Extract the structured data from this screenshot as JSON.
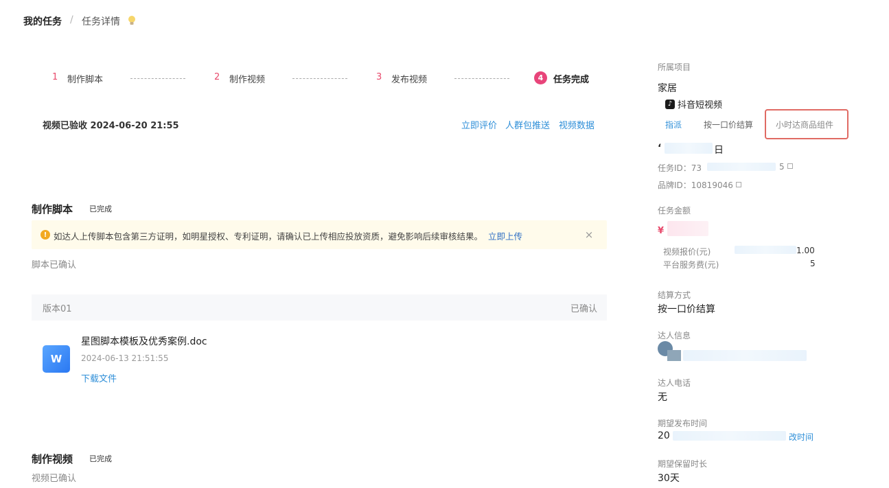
{
  "breadcrumb": {
    "root": "我的任务",
    "separator": "/",
    "current": "任务详情"
  },
  "steps": [
    {
      "number": "1",
      "label": "制作脚本"
    },
    {
      "number": "2",
      "label": "制作视频"
    },
    {
      "number": "3",
      "label": "发布视频"
    },
    {
      "number": "4",
      "label": "任务完成"
    }
  ],
  "status": {
    "text": "视频已验收 2024-06-20 21:55",
    "actions": [
      "立即评价",
      "人群包推送",
      "视频数据"
    ]
  },
  "script_section": {
    "title": "制作脚本",
    "badge": "已完成",
    "alert_text": "如达人上传脚本包含第三方证明，如明星授权、专利证明，请确认已上传相应投放资质，避免影响后续审核结果。",
    "alert_link": "立即上传",
    "alert_icon": "!",
    "alert_close": "×",
    "confirmed_text": "脚本已确认",
    "version": {
      "label": "版本01",
      "status": "已确认"
    },
    "file": {
      "icon_letter": "W",
      "name": "星图脚本模板及优秀案例.doc",
      "time": "2024-06-13 21:51:55",
      "download": "下载文件"
    }
  },
  "video_section": {
    "title": "制作视频",
    "badge": "已完成",
    "confirmed_text": "视频已确认"
  },
  "sidebar": {
    "project_label": "所属项目",
    "project_value": "家居",
    "platform": "抖音短视频",
    "tags": [
      "指派",
      "按一口价结算",
      "小时达商品组件"
    ],
    "task_name_partial": "日",
    "task_id_label": "任务ID：73",
    "task_id_tail": "5",
    "brand_id_label": "品牌ID：10819046",
    "amount_label": "任务金额",
    "amount_mark": "¥",
    "quote_label": "视频报价(元)",
    "fee_label": "平台服务费(元)",
    "quote_tail": "1.00",
    "fee_tail": "5",
    "settle_label": "结算方式",
    "settle_value": "按一口价结算",
    "talent_label": "达人信息",
    "phone_label": "达人电话",
    "phone_value": "无",
    "publish_label": "期望发布时间",
    "publish_value_partial": "20",
    "publish_edit": "改时间",
    "retain_label": "期望保留时长",
    "retain_value": "30天"
  },
  "colors": {
    "accent": "#e8457a",
    "link": "#2f8fd8",
    "highlight_border": "#e06a63",
    "alert_bg": "#fffbeb"
  }
}
